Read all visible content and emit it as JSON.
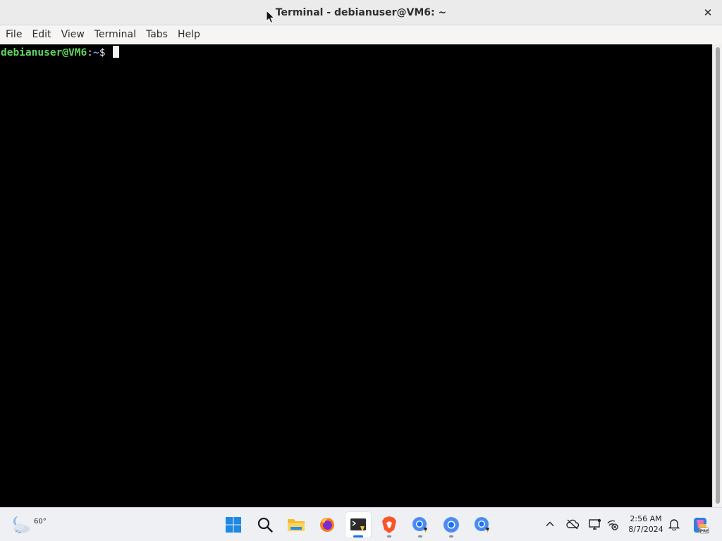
{
  "window": {
    "title": "Terminal - debianuser@VM6: ~",
    "close_label": "✕"
  },
  "menubar": {
    "items": [
      "File",
      "Edit",
      "View",
      "Terminal",
      "Tabs",
      "Help"
    ]
  },
  "terminal": {
    "prompt_user_host": "debianuser@VM6",
    "prompt_sep": ":",
    "prompt_path": "~",
    "prompt_symbol": "$ "
  },
  "taskbar": {
    "weather_temp": "60°",
    "apps": [
      {
        "name": "start-button",
        "icon": "windows-logo-icon"
      },
      {
        "name": "search-button",
        "icon": "search-icon"
      },
      {
        "name": "file-explorer",
        "icon": "folder-icon"
      },
      {
        "name": "firefox",
        "icon": "firefox-icon"
      },
      {
        "name": "terminal",
        "icon": "terminal-icon",
        "state": "active"
      },
      {
        "name": "brave",
        "icon": "brave-icon",
        "state": "open"
      },
      {
        "name": "chrome-linux-1",
        "icon": "chrome-linux-icon",
        "state": "open"
      },
      {
        "name": "chrome",
        "icon": "chrome-icon",
        "state": "open"
      },
      {
        "name": "chrome-linux-2",
        "icon": "chrome-linux-icon"
      }
    ],
    "tray_icons": [
      "chevron-up-icon",
      "cloud-off-icon",
      "display-icon",
      "network-icon"
    ],
    "clock_time": "2:56 AM",
    "clock_date": "8/7/2024",
    "colors": {
      "accent": "#1a73e8",
      "prompt_green": "#5fd75f",
      "prompt_blue": "#6c9cff"
    }
  }
}
